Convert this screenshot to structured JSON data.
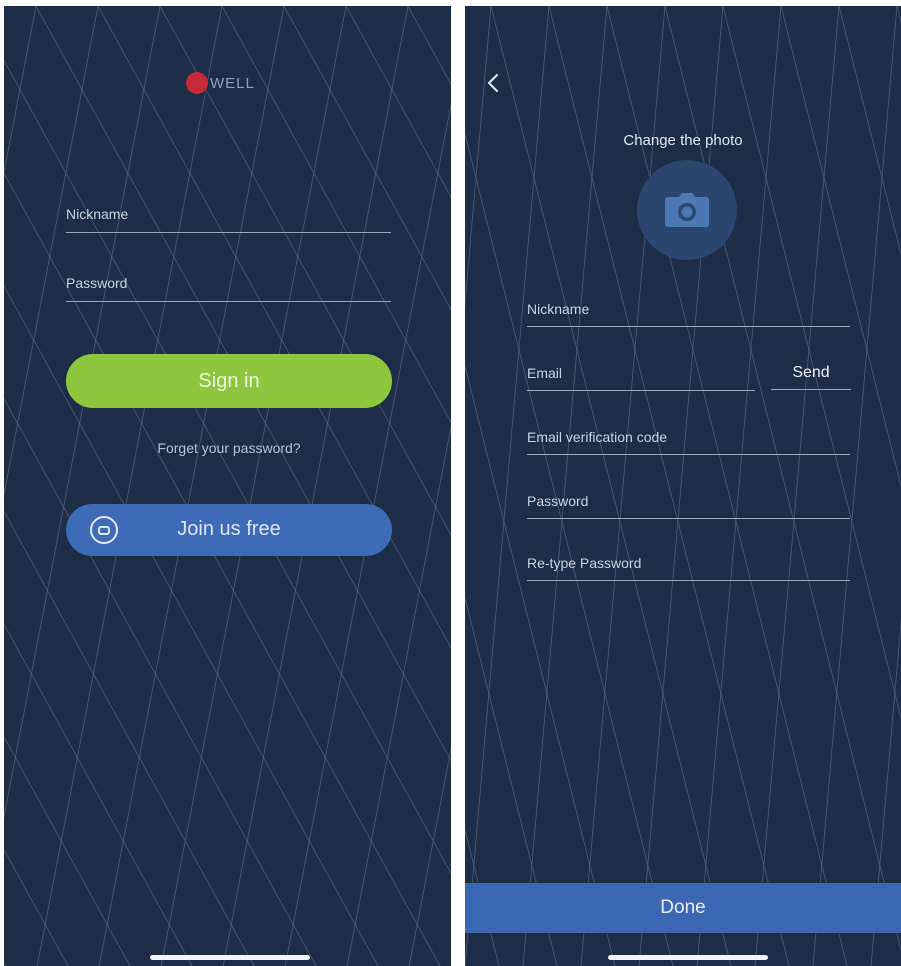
{
  "colors": {
    "background": "#1e2c45",
    "sign_in_green": "#8ec63f",
    "join_blue": "#3c6bb8",
    "done_blue": "#3a68b4",
    "logo_red": "#c42a3a",
    "photo_circle": "#2c4670"
  },
  "login": {
    "logo_text": "WELL",
    "nickname_placeholder": "Nickname",
    "password_placeholder": "Password",
    "sign_in_label": "Sign in",
    "forgot_label": "Forget your password?",
    "join_label": "Join us free",
    "join_icon": "chat-bubble-icon"
  },
  "register": {
    "back_icon": "chevron-left-icon",
    "photo_title": "Change the photo",
    "photo_icon": "camera-icon",
    "nickname_placeholder": "Nickname",
    "email_placeholder": "Email",
    "send_label": "Send",
    "code_placeholder": "Email verification code",
    "password_placeholder": "Password",
    "retype_placeholder": "Re-type Password",
    "done_label": "Done"
  }
}
